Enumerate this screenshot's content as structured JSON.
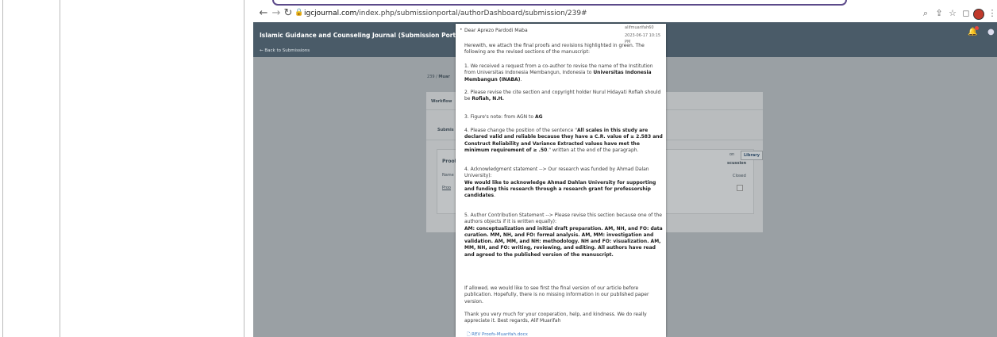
{
  "browser": {
    "url_domain": "igcjournal.com",
    "url_path": "/index.php/submissionportal/authorDashboard/submission/239#"
  },
  "site": {
    "title": "Islamic Guidance and Counseling Journal (Submission Portal - New!)",
    "back_link": "← Back to Submissions"
  },
  "background": {
    "breadcrumb_id": "239",
    "breadcrumb_sep": "/",
    "breadcrumb_author": "Muar",
    "tab_workflow": "Workflow",
    "tab_submission": "Submis",
    "library": "Library",
    "library_prefix": "on",
    "proofs_heading": "Proof",
    "name_col": "Name",
    "proofs_link": "Proo",
    "discussion_col": "scussion",
    "closed_col": "Closed"
  },
  "message": {
    "sender": "alifmuarifah60",
    "date": "2023-06-17 10:15 PM",
    "greeting": "Dear Aprezo Pardodi Maba",
    "intro": "Herewith, we attach the final proofs and revisions highlighted in green. The following are the revised sections of the manuscript:",
    "item1_pre": "1. We received a request from a co-author to revise the name of the Institution from Universitas Indonesia Membangun, Indonesia to ",
    "item1_bold": "Universitas Indonesia Membangun (INABA)",
    "item1_post": ".",
    "item2_pre": "2. Please revise the cite section and copyright holder Nurul Hidayati Rofiah should be ",
    "item2_bold": "Rofiah, N.H.",
    "item3_pre": "3. Figure's note: from AGN to ",
    "item3_bold": "AG",
    "item4_pre": "4. Please change the position of the sentence \"",
    "item4_bold": "All scales in this study are declared valid and reliable because they have a C.R. value of ≥ 2.583 and Construct Reliability and Variance Extracted values have met the minimum requirement of ≥ .50",
    "item4_post": ".\" written at the end of the paragraph.",
    "item5_pre": "4. Acknowledgment statement --> Our research was funded by Ahmad Dalan University):",
    "item5_bold": "We would like to acknowledge Ahmad Dahlan University for supporting and funding this research through a research grant for professorship candidates",
    "item5_post": ".",
    "item6_pre": "5. Author Contribution Statement --> Please revise this section because one of the authors objects if it is written equally):",
    "item6_bold": "AM: conceptualization and initial draft preparation. AM, NH, and FO: data curation. MM, NH, and FO: formal analysis. AM, MM: investigation and validation. AM, MM, and NH: methodology. NH and FO: visualization. AM, MM, NH, and FO: writing, reviewing, and editing. All authors have read and agreed to the published version of the manuscript.",
    "closing1": "If allowed, we would like to see first the final version of our article before publication. Hopefully, there is no missing information in our published paper version.",
    "closing2": "Thank you very much for your cooperation, help, and kindness. We do really appreciate it.   Best regards,   Alif Muarifah",
    "attachment": "REV Proofs-Muarifah.docx"
  }
}
